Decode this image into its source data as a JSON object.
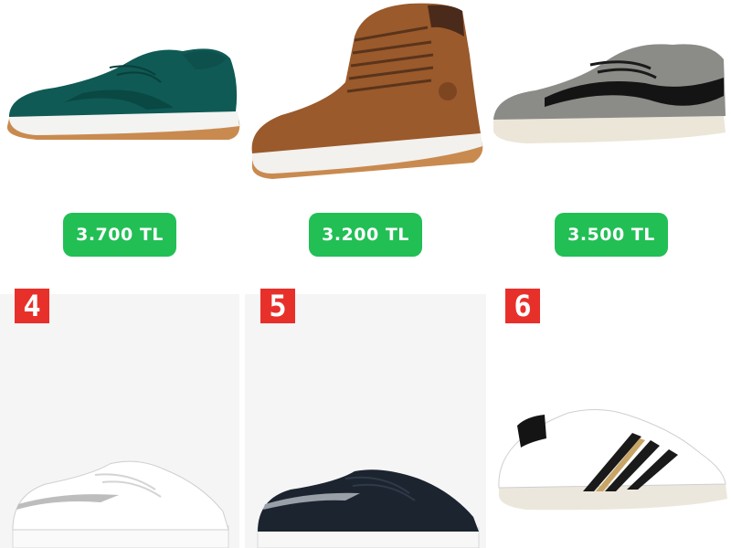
{
  "products": [
    {
      "id": 1,
      "name": "teal suede low sneaker",
      "price": "3.700 TL"
    },
    {
      "id": 2,
      "name": "brown leather chukka boot",
      "price": "3.200 TL"
    },
    {
      "id": 3,
      "name": "grey suede low sneaker",
      "price": "3.500 TL"
    },
    {
      "id": 4,
      "name": "white leather low sneaker",
      "number": "4"
    },
    {
      "id": 5,
      "name": "black leather low sneaker",
      "number": "5"
    },
    {
      "id": 6,
      "name": "white three-stripe sneaker",
      "number": "6"
    }
  ],
  "colors": {
    "price_badge": "#22bf55",
    "number_badge": "#e8302a",
    "tile_background": "#f5f5f5"
  },
  "icons": [
    "boot-logo-icon",
    "stripes-logo-icon"
  ]
}
